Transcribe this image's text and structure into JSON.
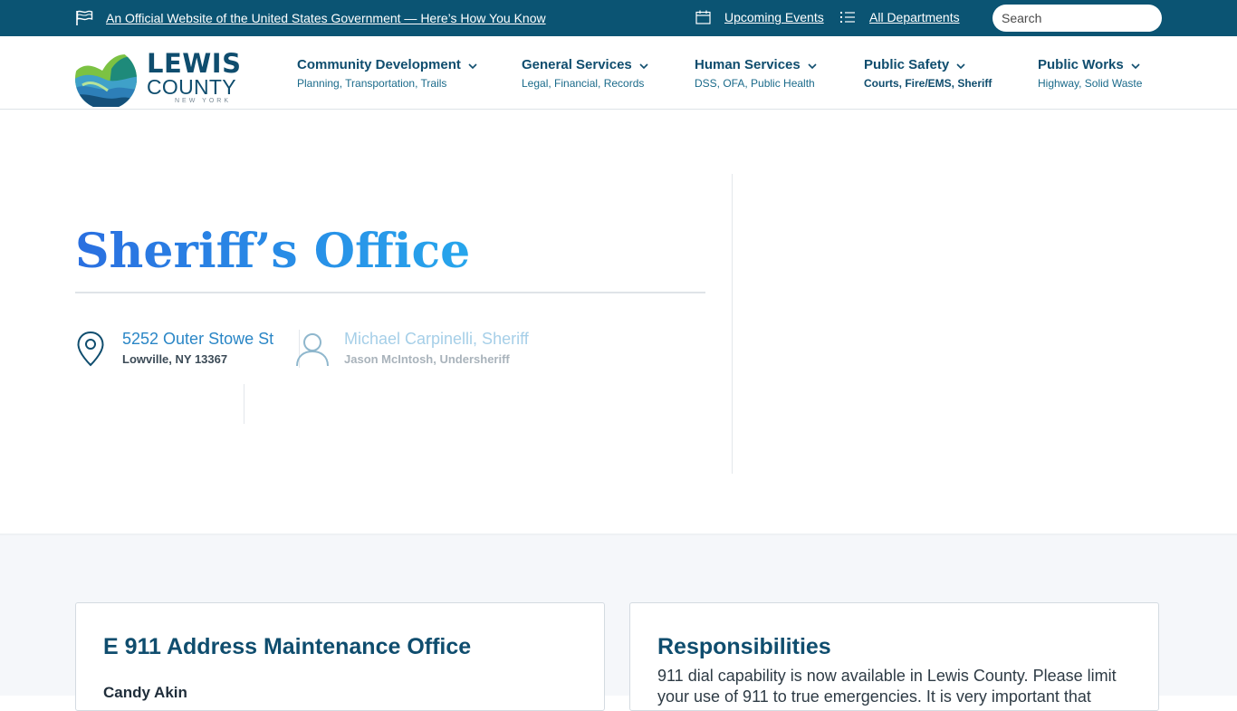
{
  "topbar": {
    "gov_text": "An Official Website of the United States Government — Here’s How You Know",
    "events_label": "Upcoming Events",
    "departments_label": "All Departments",
    "search_placeholder": "Search"
  },
  "logo": {
    "line1": "LEWIS",
    "line2": "COUNTY",
    "line3": "NEW YORK"
  },
  "nav": [
    {
      "label": "Community Development",
      "sub": "Planning, Transportation, Trails"
    },
    {
      "label": "General Services",
      "sub": "Legal, Financial, Records"
    },
    {
      "label": "Human Services",
      "sub": "DSS, OFA, Public Health"
    },
    {
      "label": "Public Safety",
      "sub": "Courts, Fire/EMS, Sheriff"
    },
    {
      "label": "Public Works",
      "sub": "Highway, Solid Waste"
    }
  ],
  "hero": {
    "title": "Sheriff’s Office",
    "address_line1": "5252 Outer Stowe St",
    "address_line2": "Lowville, NY 13367",
    "contact_line1": "Michael Carpinelli, Sheriff",
    "contact_line2": "Jason McIntosh, Undersheriff"
  },
  "cards": {
    "left_title": "E 911 Address Maintenance Office",
    "left_name": "Candy Akin",
    "right_title": "Responsibilities",
    "right_text": "911 dial capability is now available in Lewis County. Please limit your use of 911 to true emergencies. It is very important that"
  },
  "colors": {
    "topbar_bg": "#0b5473",
    "brand_dark": "#0f4d6e",
    "accent_blue": "#2a86c6",
    "active_tab": "#1b8fbf"
  },
  "icons": {
    "flag": "flag-icon",
    "calendar": "calendar-icon",
    "list": "list-icon",
    "chevron": "chevron-down-icon",
    "location": "map-pin-icon",
    "person": "person-icon"
  }
}
